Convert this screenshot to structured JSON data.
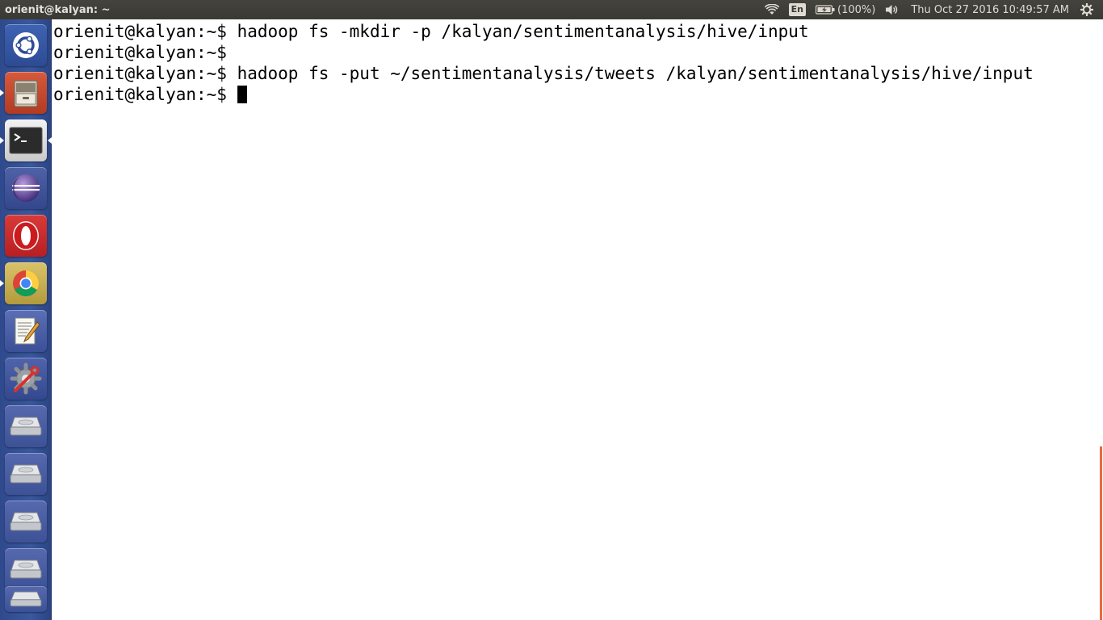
{
  "top_panel": {
    "window_title": "orienit@kalyan: ~",
    "keyboard_layout": "En",
    "battery_text": "(100%)",
    "clock": "Thu Oct 27 2016 10:49:57 AM"
  },
  "launcher": {
    "items": [
      {
        "name": "dash-home",
        "icon": "ubuntu-logo-icon"
      },
      {
        "name": "files",
        "icon": "file-cabinet-icon",
        "running": true
      },
      {
        "name": "terminal",
        "icon": "terminal-icon",
        "running": true,
        "active": true
      },
      {
        "name": "eclipse",
        "icon": "eclipse-icon"
      },
      {
        "name": "opera",
        "icon": "opera-icon"
      },
      {
        "name": "chrome",
        "icon": "chrome-icon",
        "running": true
      },
      {
        "name": "text-editor",
        "icon": "text-editor-icon"
      },
      {
        "name": "system-settings",
        "icon": "settings-gear-icon"
      },
      {
        "name": "drive-1",
        "icon": "hard-drive-icon"
      },
      {
        "name": "drive-2",
        "icon": "hard-drive-icon"
      },
      {
        "name": "drive-3",
        "icon": "hard-drive-icon"
      },
      {
        "name": "drive-4",
        "icon": "hard-drive-icon"
      },
      {
        "name": "drive-5",
        "icon": "hard-drive-icon"
      }
    ]
  },
  "terminal": {
    "prompt": "orienit@kalyan:~$",
    "lines": [
      {
        "prompt": "orienit@kalyan:~$",
        "command": " hadoop fs -mkdir -p /kalyan/sentimentanalysis/hive/input"
      },
      {
        "prompt": "orienit@kalyan:~$",
        "command": ""
      },
      {
        "prompt": "orienit@kalyan:~$",
        "command": " hadoop fs -put ~/sentimentanalysis/tweets /kalyan/sentimentanalysis/hive/input"
      },
      {
        "prompt": "orienit@kalyan:~$",
        "command": " "
      }
    ]
  },
  "colors": {
    "panel_bg": "#3c3b37",
    "launcher_bg": "#34529a",
    "terminal_bg": "#ffffff",
    "terminal_fg": "#000000",
    "scroll_accent": "#e86c3a"
  }
}
